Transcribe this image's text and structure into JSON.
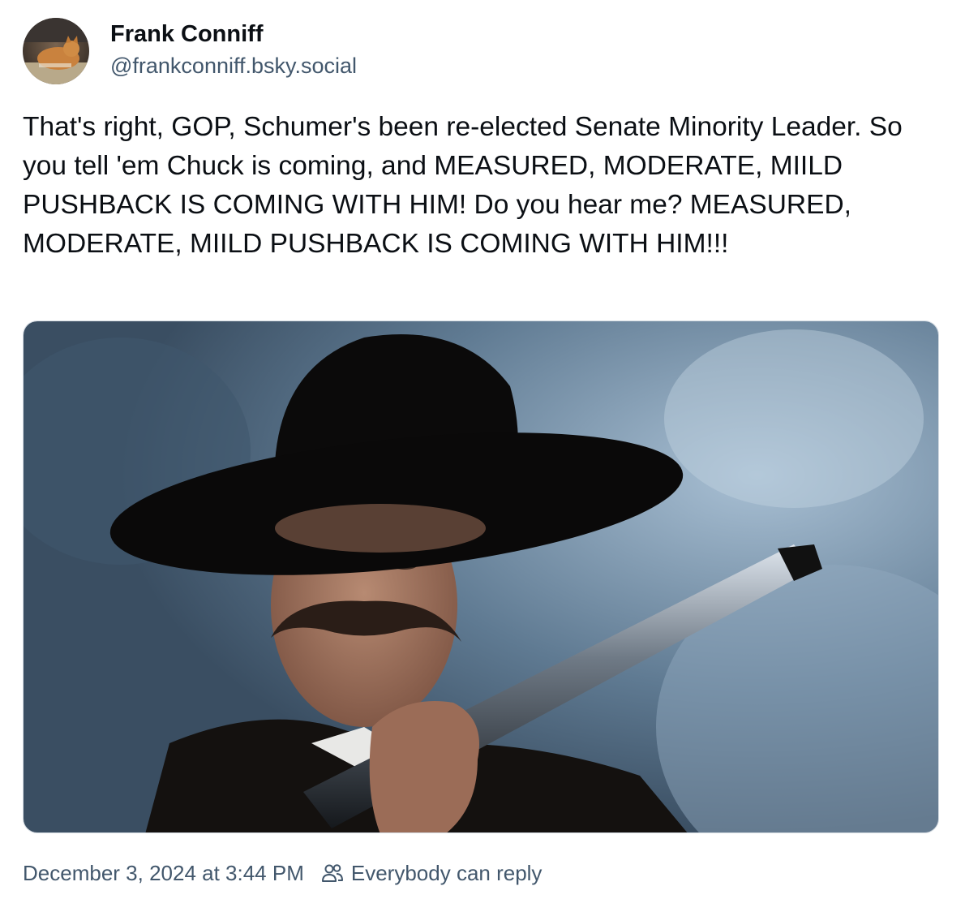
{
  "author": {
    "display_name": "Frank Conniff",
    "handle": "@frankconniff.bsky.social",
    "avatar_icon": "avatar-cat-photo"
  },
  "post": {
    "text": "That's right, GOP, Schumer's been re-elected Senate Minority Leader. So you tell 'em Chuck is coming, and MEASURED, MODERATE, MIILD PUSHBACK IS COMING WITH HIM! Do you hear me? MEASURED, MODERATE, MIILD PUSHBACK IS COMING WITH HIM!!!",
    "media_icon": "embedded-photo"
  },
  "footer": {
    "timestamp": "December 3, 2024 at 3:44 PM",
    "reply_icon": "people-icon",
    "reply_setting": "Everybody can reply"
  },
  "colors": {
    "text_primary": "#0b0f14",
    "text_secondary": "#42576c",
    "media_border": "#d4dbe2"
  }
}
